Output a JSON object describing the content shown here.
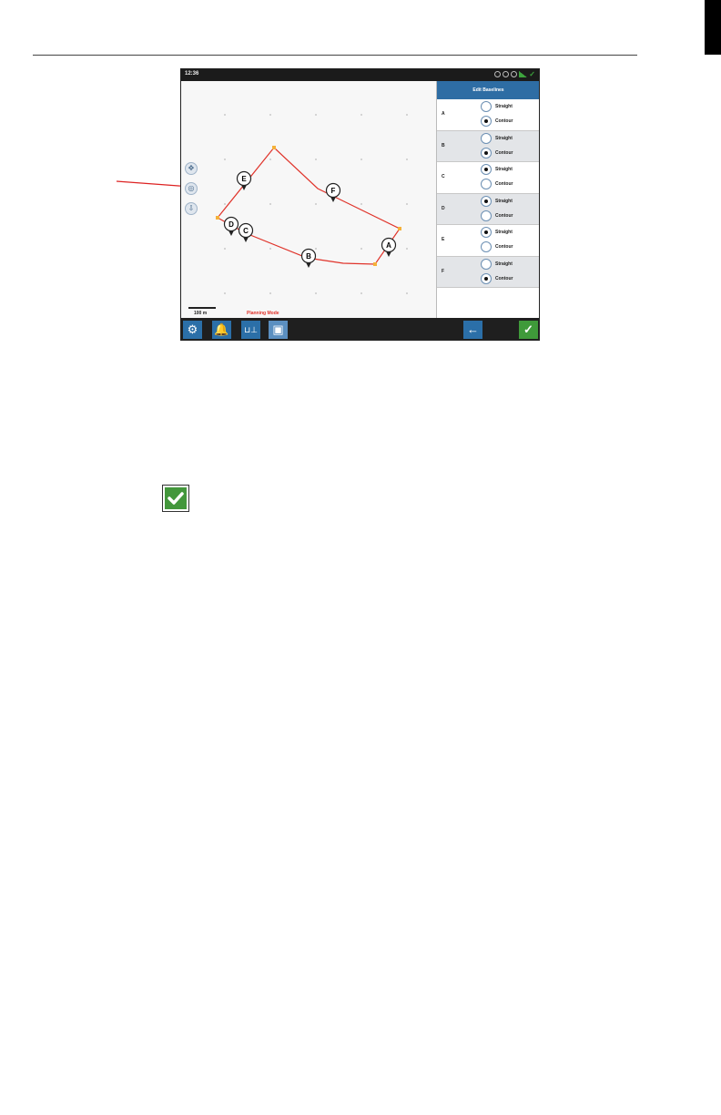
{
  "screen": {
    "status_time": "12:36",
    "panel_title": "Edit Baselines",
    "scale_label": "100 m",
    "mode_label": "Planning Mode",
    "pins": [
      "E",
      "F",
      "D",
      "C",
      "A",
      "B"
    ],
    "segments": [
      {
        "label": "A",
        "option1": "Straight",
        "option2": "Contour",
        "selected": "Contour"
      },
      {
        "label": "B",
        "option1": "Straight",
        "option2": "Contour",
        "selected": "Contour"
      },
      {
        "label": "C",
        "option1": "Straight",
        "option2": "Contour",
        "selected": "Straight"
      },
      {
        "label": "D",
        "option1": "Straight",
        "option2": "Contour",
        "selected": "Straight"
      },
      {
        "label": "E",
        "option1": "Straight",
        "option2": "Contour",
        "selected": "Straight"
      },
      {
        "label": "F",
        "option1": "Straight",
        "option2": "Contour",
        "selected": "Contour"
      }
    ],
    "toolbar_icons": [
      "gear-icon",
      "bell-icon",
      "tool-icon",
      "camera-icon",
      "back-arrow-icon",
      "confirm-check-icon"
    ],
    "colors": {
      "boundary": "#e0332a",
      "accent": "#2e6da4",
      "confirm": "#3f9a3a"
    }
  }
}
